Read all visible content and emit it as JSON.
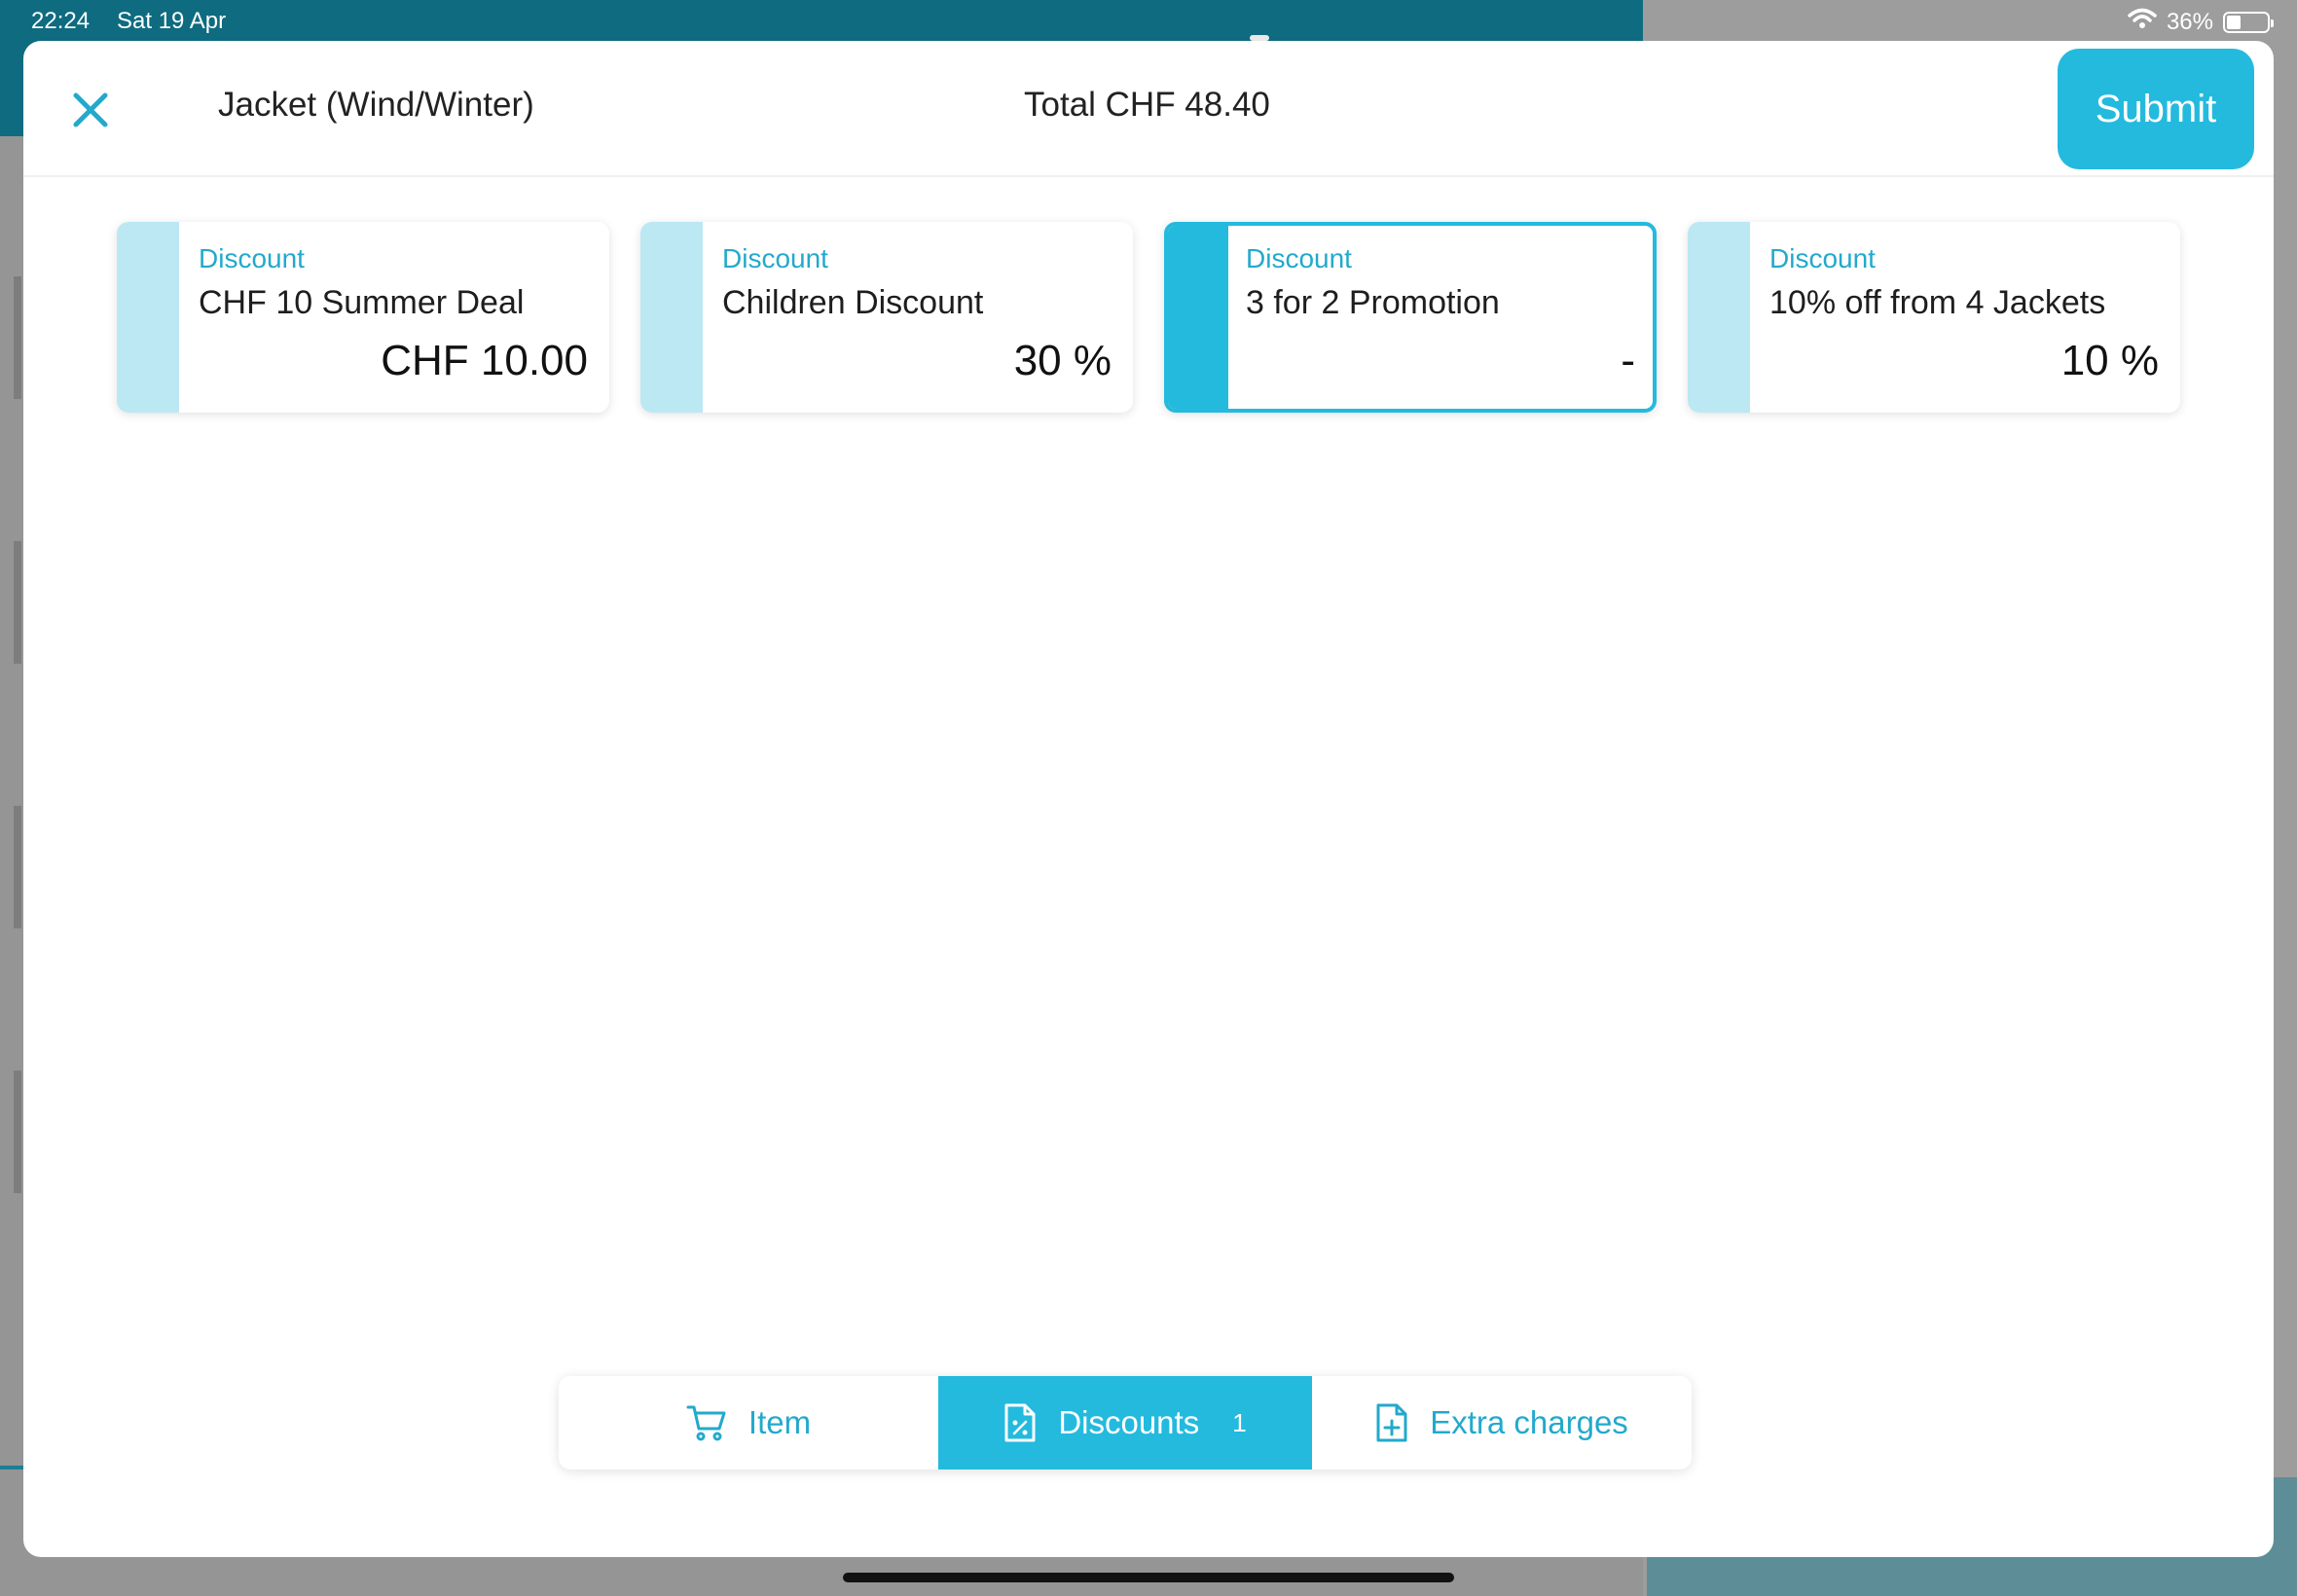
{
  "status_bar": {
    "time": "22:24",
    "date": "Sat 19 Apr",
    "battery_percent": "36%",
    "battery_level": 0.36
  },
  "header": {
    "item_title": "Jacket (Wind/Winter)",
    "total": "Total CHF 48.40",
    "submit_label": "Submit"
  },
  "discounts": [
    {
      "type": "Discount",
      "name": "CHF 10 Summer Deal",
      "value": "CHF 10.00",
      "selected": false
    },
    {
      "type": "Discount",
      "name": "Children Discount",
      "value": "30 %",
      "selected": false
    },
    {
      "type": "Discount",
      "name": "3 for 2 Promotion",
      "value": "-",
      "selected": true
    },
    {
      "type": "Discount",
      "name": "10% off from 4 Jackets",
      "value": "10 %",
      "selected": false
    }
  ],
  "tabs": {
    "item": {
      "label": "Item",
      "icon": "cart-icon"
    },
    "discounts": {
      "label": "Discounts",
      "badge": "1",
      "icon": "percent-document-icon",
      "active": true
    },
    "extra": {
      "label": "Extra charges",
      "icon": "add-document-icon"
    }
  },
  "background": {
    "right_partial_char": ")"
  },
  "colors": {
    "accent": "#23bade",
    "accent_light": "#bce8f3",
    "header_teal": "#0e6b80"
  }
}
